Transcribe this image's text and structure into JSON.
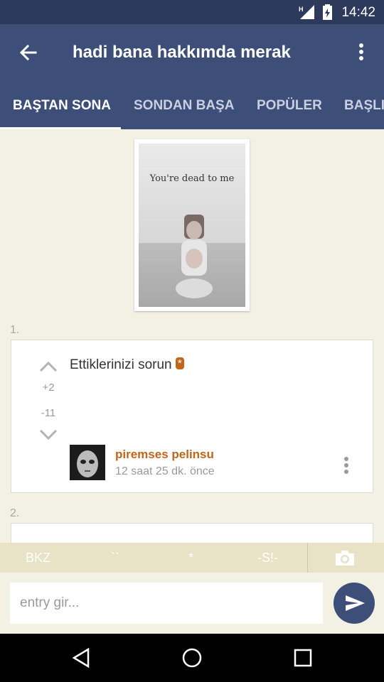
{
  "status_bar": {
    "time": "14:42",
    "network_letter": "H"
  },
  "app_bar": {
    "title": "hadi bana hakkımda merak",
    "back_icon": "back-arrow-icon",
    "more_icon": "more-vertical-icon"
  },
  "tabs": [
    {
      "label": "BAŞTAN SONA",
      "active": true
    },
    {
      "label": "SONDAN BAŞA",
      "active": false
    },
    {
      "label": "POPÜLER",
      "active": false
    },
    {
      "label": "BAŞLIK",
      "active": false
    }
  ],
  "image": {
    "caption": "You're dead to me"
  },
  "entries": [
    {
      "number": "1.",
      "text": "Ettiklerinizi sorun",
      "link_badge": "*",
      "upvotes": "+2",
      "downvotes": "-11",
      "author": "piremses pelinsu",
      "time": "12 saat 25 dk. önce"
    },
    {
      "number": "2."
    }
  ],
  "toolbar": {
    "bkz": "BKZ",
    "backticks": "``",
    "star": "*",
    "spoiler": "-S!-",
    "camera_icon": "camera-icon"
  },
  "composer": {
    "placeholder": "entry gir...",
    "send_icon": "send-icon"
  },
  "nav": {
    "back_icon": "nav-back-icon",
    "home_icon": "nav-home-icon",
    "recents_icon": "nav-recents-icon"
  },
  "colors": {
    "primary": "#3d4e78",
    "status_bar": "#2d3a5c",
    "accent": "#c0651a",
    "background": "#f3f0e4",
    "toolbar": "#e8e2c6"
  }
}
